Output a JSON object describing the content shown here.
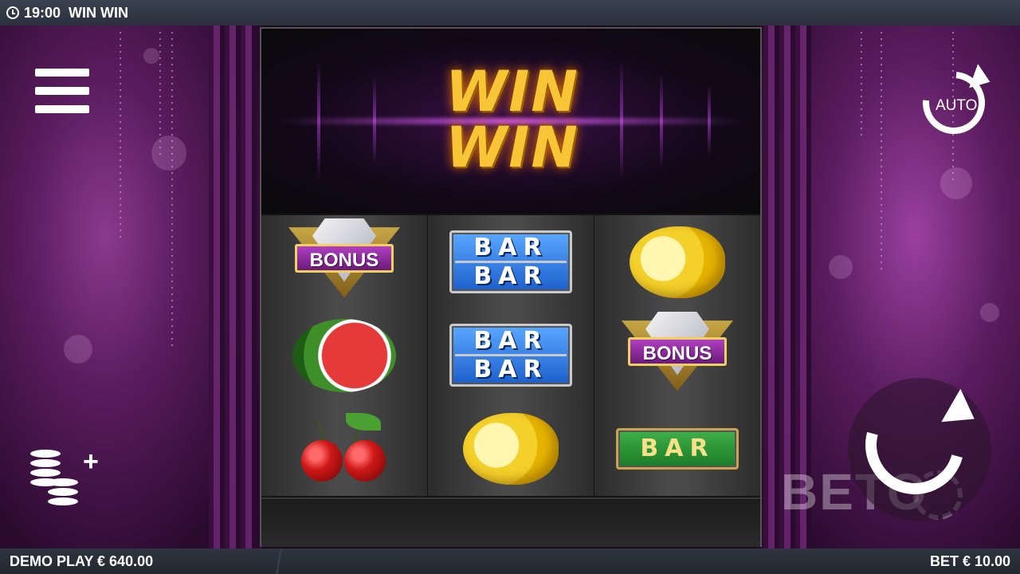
{
  "top_bar": {
    "time": "19:00",
    "game_title": "WIN WIN"
  },
  "logo": {
    "line1": "WIN",
    "line2": "WIN"
  },
  "reels": [
    [
      "bonus",
      "watermelon",
      "cherries"
    ],
    [
      "double-bar",
      "double-bar",
      "lemon"
    ],
    [
      "lemon",
      "bonus",
      "single-bar"
    ]
  ],
  "symbols": {
    "bar": "BAR",
    "bonus": "BONUS"
  },
  "controls": {
    "auto_label": "AUTO"
  },
  "bottom_bar": {
    "balance": "DEMO PLAY € 640.00",
    "bet": "BET € 10.00"
  },
  "watermark": "BETO",
  "colors": {
    "logo_gold": "#f7c536",
    "background_purple": "#5a1c5e",
    "bar_blue": "#1d5fcc",
    "bar_green": "#1b7a25",
    "bonus_purple": "#b040c0"
  }
}
